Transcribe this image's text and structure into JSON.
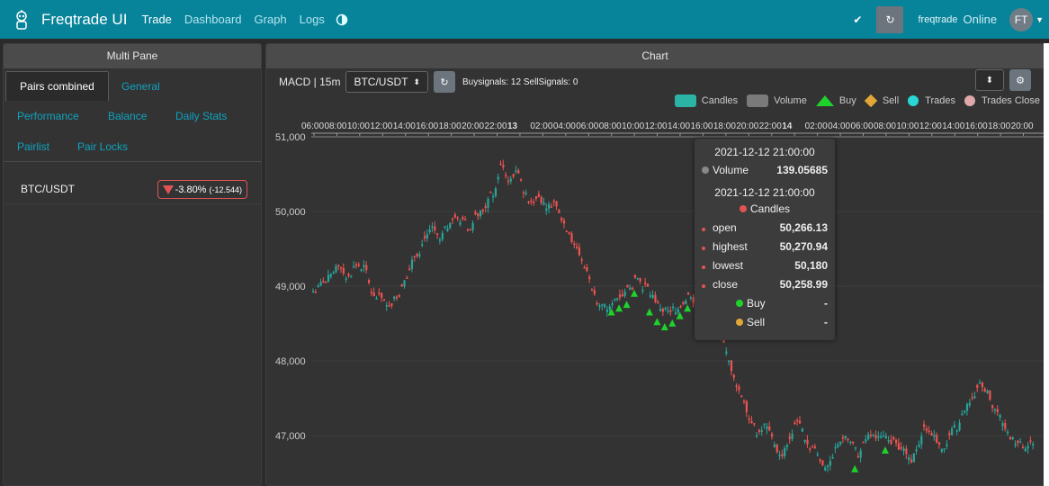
{
  "nav": {
    "brand": "Freqtrade UI",
    "items": [
      "Trade",
      "Dashboard",
      "Graph",
      "Logs"
    ],
    "bot_name": "freqtrade",
    "status": "Online",
    "avatar": "FT",
    "icons": {
      "logo": "freqtrade-logo-icon",
      "theme": "theme-toggle-icon",
      "check": "check-icon",
      "refresh": "refresh-icon"
    }
  },
  "multi_pane": {
    "title": "Multi Pane",
    "tabs": [
      "Pairs combined",
      "General",
      "Performance",
      "Balance",
      "Daily Stats",
      "Pairlist",
      "Pair Locks"
    ],
    "pairs": [
      {
        "pair": "BTC/USDT",
        "change": "-3.80%",
        "abs": "(-12.544)"
      }
    ]
  },
  "chart_pane": {
    "title": "Chart",
    "strategy_tf": "MACD | 15m",
    "pair_select": "BTC/USDT",
    "signals": "Buysignals: 12  SellSignals: 0",
    "colors": {
      "up": "#26a69a",
      "down": "#ef5350",
      "buy": "#1fd12b",
      "sell": "#e2a736",
      "trades": "#2ad6d6",
      "trades_close": "#e0a8a8"
    },
    "legend": [
      "Candles",
      "Volume",
      "Buy",
      "Sell",
      "Trades",
      "Trades Close"
    ],
    "tooltip": {
      "time1": "2021-12-12 21:00:00",
      "volume_label": "Volume",
      "volume_value": "139.05685",
      "time2": "2021-12-12 21:00:00",
      "candles_label": "Candles",
      "open_label": "open",
      "open": "50,266.13",
      "high_label": "highest",
      "high": "50,270.94",
      "low_label": "lowest",
      "low": "50,180",
      "close_label": "close",
      "close": "50,258.99",
      "buy_label": "Buy",
      "buy": "-",
      "sell_label": "Sell",
      "sell": "-"
    }
  },
  "chart_data": {
    "type": "candlestick",
    "y_ticks": [
      "51,000",
      "50,000",
      "49,000",
      "48,000",
      "47,000"
    ],
    "ylim": [
      46400,
      51050
    ],
    "x_tick_labels": [
      "06:00",
      "08:00",
      "10:00",
      "12:00",
      "14:00",
      "16:00",
      "18:00",
      "20:00",
      "22:00",
      "13",
      "02:00",
      "04:00",
      "06:00",
      "08:00",
      "10:00",
      "12:00",
      "14:00",
      "16:00",
      "18:00",
      "20:00",
      "22:00",
      "14",
      "02:00",
      "04:00",
      "06:00",
      "08:00",
      "10:00",
      "12:00",
      "14:00",
      "16:00",
      "18:00",
      "20:00"
    ],
    "grid": true,
    "closes": [
      48960,
      49050,
      49180,
      49260,
      49120,
      49300,
      49250,
      48950,
      48850,
      48720,
      48820,
      48960,
      49200,
      49450,
      49650,
      49800,
      49620,
      49780,
      49920,
      49860,
      49750,
      49950,
      50050,
      50250,
      50600,
      50450,
      50500,
      50300,
      50150,
      50200,
      50100,
      50120,
      49900,
      49750,
      49500,
      49300,
      49000,
      48800,
      48700,
      48850,
      48900,
      48950,
      49100,
      48980,
      48850,
      48720,
      48650,
      48700,
      48800,
      48900,
      48780,
      48650,
      48500,
      48300,
      48000,
      47700,
      47500,
      47200,
      47000,
      47150,
      46900,
      46700,
      46950,
      47200,
      47000,
      46850,
      46700,
      46600,
      46800,
      47000,
      46900,
      46750,
      46900,
      47050,
      46950,
      47000,
      46900,
      46800,
      46700,
      46900,
      47100,
      47000,
      46850,
      46950,
      47100,
      47300,
      47500,
      47700,
      47600,
      47350,
      47200,
      47000,
      46900,
      46800,
      46950
    ]
  }
}
